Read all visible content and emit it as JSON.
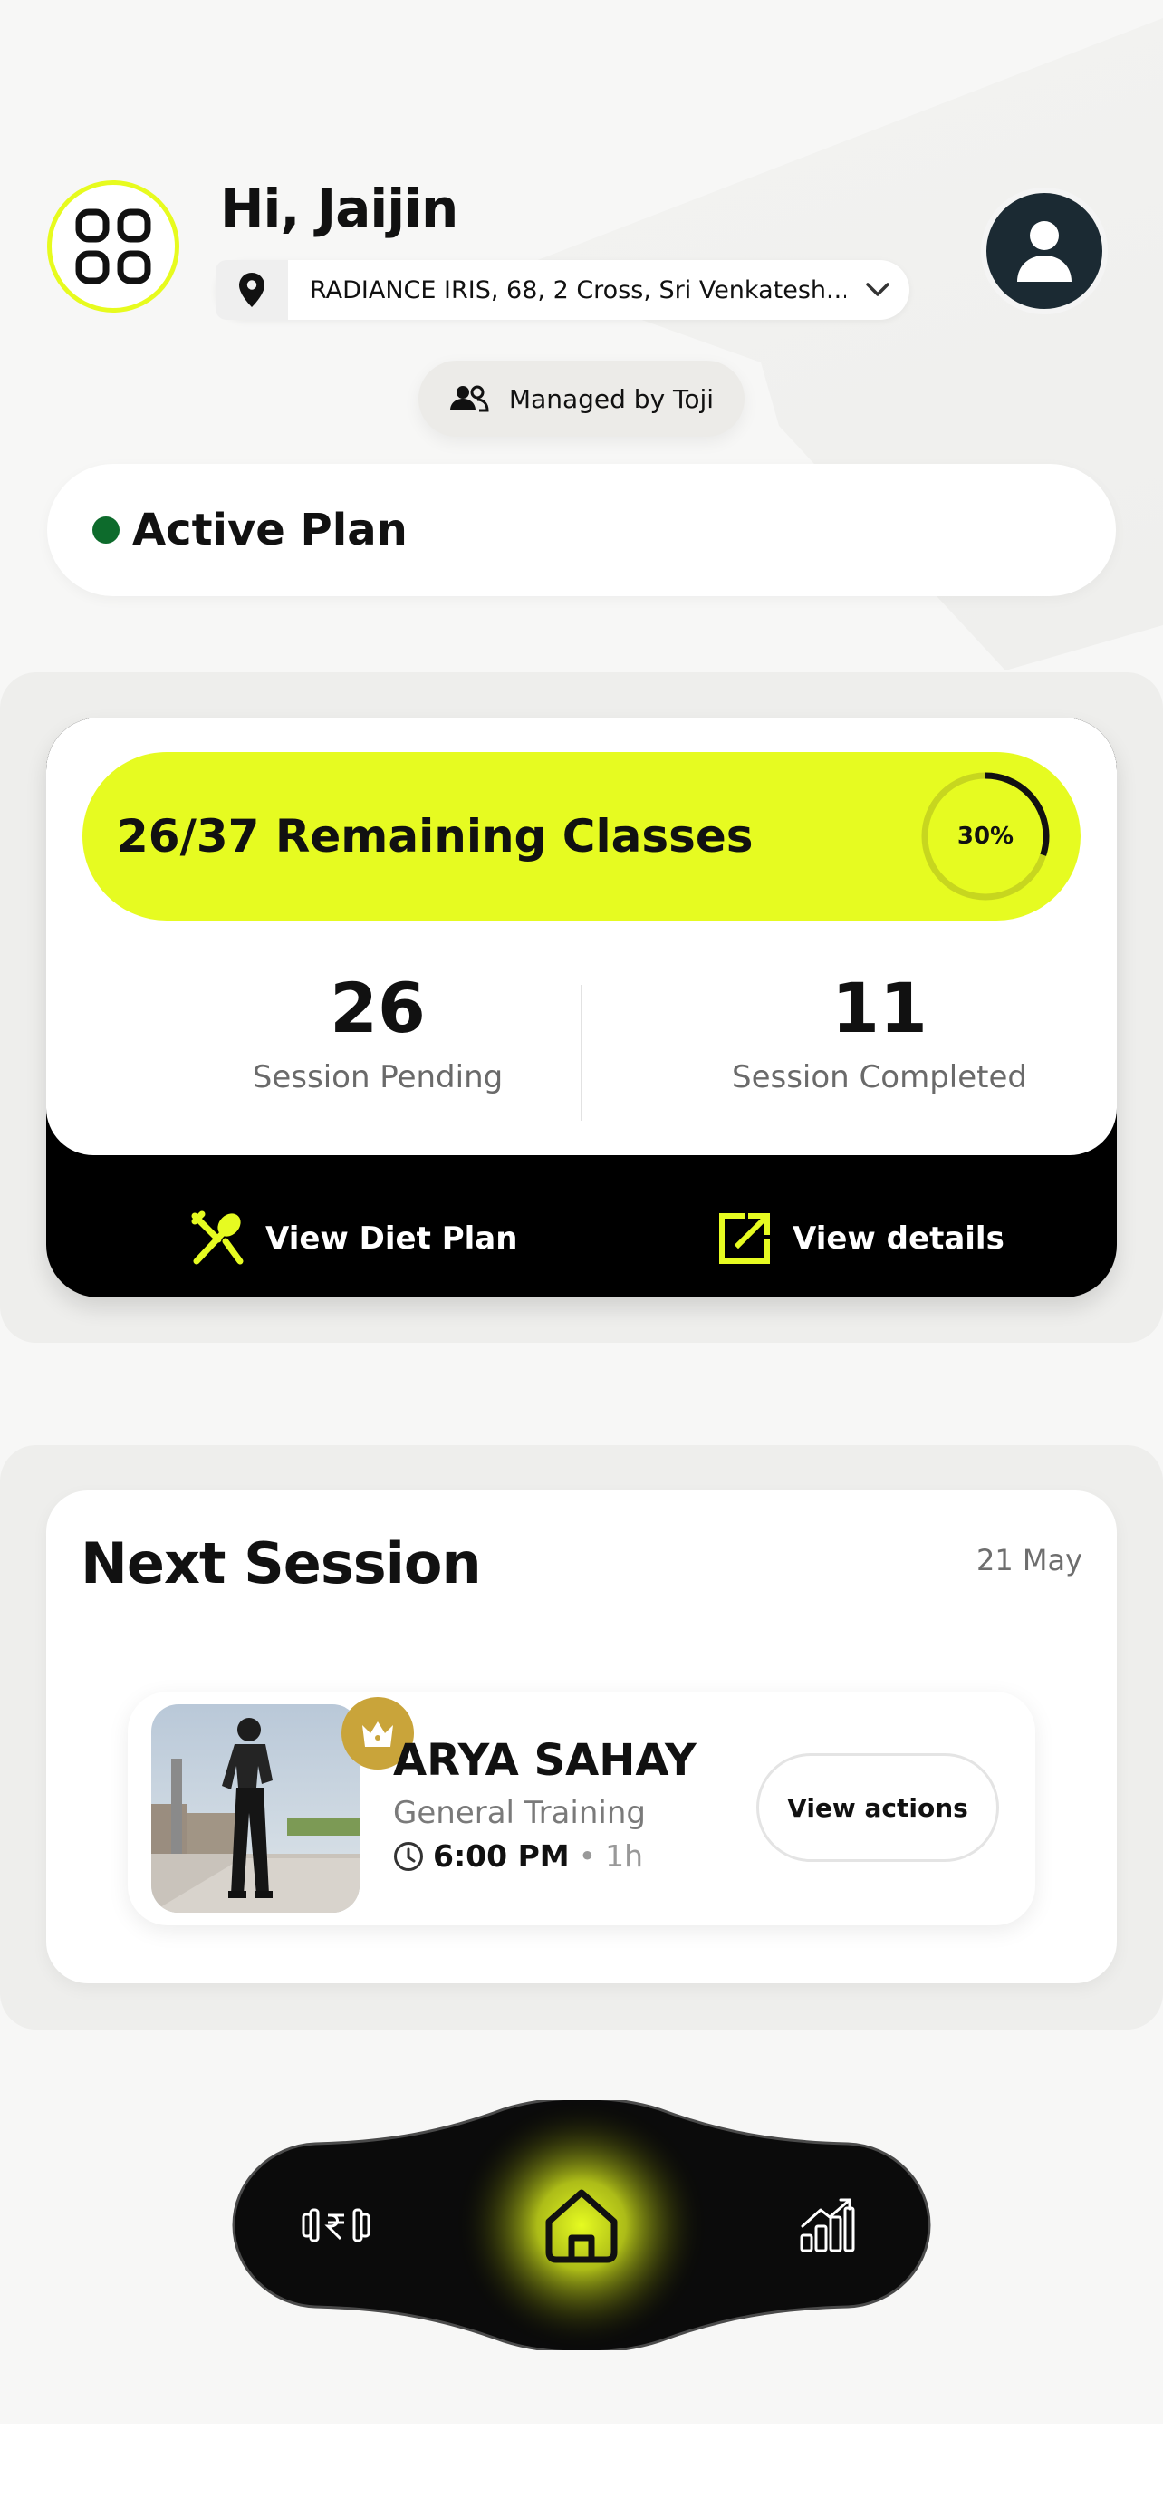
{
  "header": {
    "greeting": "Hi, Jaijin",
    "location": "RADIANCE IRIS, 68, 2 Cross, Sri Venkatesh...",
    "managed_by": "Managed by Toji"
  },
  "plan": {
    "status_label": "Active Plan",
    "status_color": "#0d6b2c",
    "remaining_text": "26/37 Remaining Classes",
    "progress_percent": 30,
    "progress_label": "30%",
    "pending_count": "26",
    "pending_label": "Session Pending",
    "completed_count": "11",
    "completed_label": "Session Completed",
    "diet_button": "View Diet Plan",
    "details_button": "View details",
    "accent_color": "#e6fb21"
  },
  "next_session": {
    "title": "Next Session",
    "date": "21 May",
    "trainer_name": "ARYA SAHAY",
    "training_type": "General Training",
    "time": "6:00 PM",
    "separator": "•",
    "duration": "1h",
    "actions_button": "View actions"
  },
  "nav": {
    "items": [
      {
        "icon": "dumbbell-rupee-icon"
      },
      {
        "icon": "home-icon",
        "active": true
      },
      {
        "icon": "stats-chart-icon"
      }
    ]
  }
}
